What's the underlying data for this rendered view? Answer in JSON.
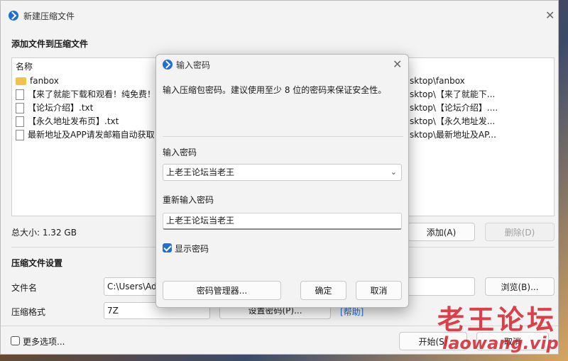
{
  "main": {
    "title": "新建压缩文件",
    "section_add": "添加文件到压缩文件",
    "list_header": "名称",
    "files": [
      {
        "name": "fanbox",
        "type": "folder",
        "path": "sktop\\fanbox"
      },
      {
        "name": "【来了就能下载和观看！纯免费！",
        "type": "file",
        "path": "sktop\\【来了就能下..."
      },
      {
        "name": "【论坛介绍】.txt",
        "type": "file",
        "path": "sktop\\【论坛介绍】...."
      },
      {
        "name": "【永久地址发布页】.txt",
        "type": "file",
        "path": "sktop\\【永久地址发..."
      },
      {
        "name": "最新地址及APP请发邮箱自动获取",
        "type": "file",
        "path": "sktop\\最新地址及AP..."
      }
    ],
    "total_size": "总大小: 1.32 GB",
    "add_button": "添加(A)",
    "remove_button": "删除(D)",
    "section_settings": "压缩文件设置",
    "filename_label": "文件名",
    "filename_value": "C:\\Users\\Ad",
    "browse_button": "浏览(B)...",
    "format_label": "压缩格式",
    "format_value": "7Z",
    "set_password_button": "设置密码(P)...",
    "help_link": "[帮助]",
    "more_options": "更多选项...",
    "start_button": "开始(S)",
    "cancel_button": "取消"
  },
  "dialog": {
    "title": "输入密码",
    "instruction": "输入压缩包密码。建议使用至少 8 位的密码来保证安全性。",
    "password_label": "输入密码",
    "password_value": "上老王论坛当老王",
    "reenter_label": "重新输入密码",
    "reenter_value": "上老王论坛当老王",
    "show_password_label": "显示密码",
    "show_password_checked": true,
    "manager_button": "密码管理器...",
    "ok_button": "确定",
    "cancel_button": "取消"
  },
  "watermark": {
    "text": "老王论坛",
    "url": "laowang.vip"
  },
  "colors": {
    "accent": "#1f6fd6",
    "watermark": "#d71e28"
  }
}
